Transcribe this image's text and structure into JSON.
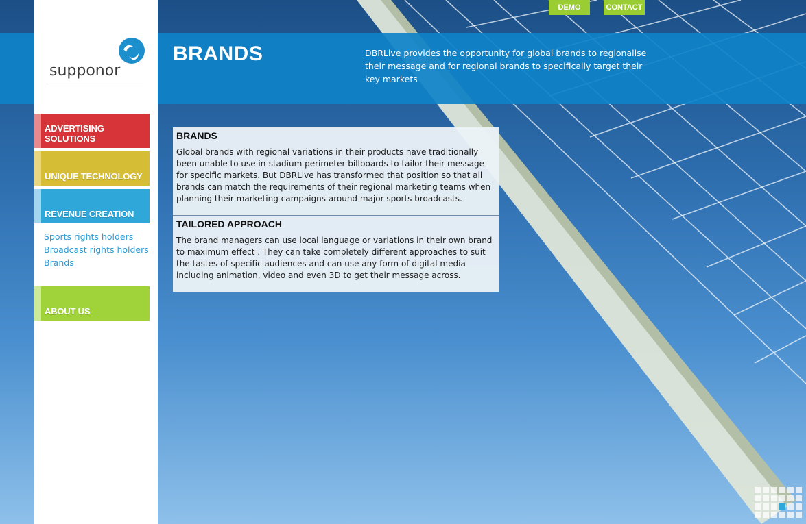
{
  "top_nav": {
    "demo": "DEMO",
    "contact": "CONTACT"
  },
  "header": {
    "title": "BRANDS",
    "description": "DBRLive provides the opportunity for global brands to regionalise their message and for regional brands to specifically target their key markets"
  },
  "brand": {
    "logo_text": "supponor"
  },
  "sidebar": {
    "items": [
      {
        "label": "ADVERTISING SOLUTIONS",
        "color": "#d7343a"
      },
      {
        "label": "UNIQUE TECHNOLOGY",
        "color": "#d6bd36"
      },
      {
        "label": "REVENUE CREATION",
        "color": "#2fa7d9"
      },
      {
        "label": "ABOUT US",
        "color": "#a0d339"
      }
    ],
    "sub_links": [
      "Sports rights holders",
      "Broadcast rights holders",
      "Brands"
    ]
  },
  "content": {
    "sections": [
      {
        "title": "BRANDS",
        "body": "Global brands with regional variations in their products have traditionally been unable to use in-stadium perimeter billboards to tailor their message for specific markets. But DBRLive has transformed that position so that all brands can match the requirements of their regional marketing teams when planning their marketing campaigns around major sports broadcasts."
      },
      {
        "title": "TAILORED APPROACH",
        "body": "The brand managers can use local language or variations in their own brand to maximum effect . They can take completely different approaches to suit the tastes of specific audiences and can use any form of digital media including animation, video and even 3D to get their message across."
      }
    ]
  },
  "colors": {
    "header_band": "#0f82c8",
    "button_green": "#9acd32",
    "link_blue": "#2c9bd6"
  }
}
